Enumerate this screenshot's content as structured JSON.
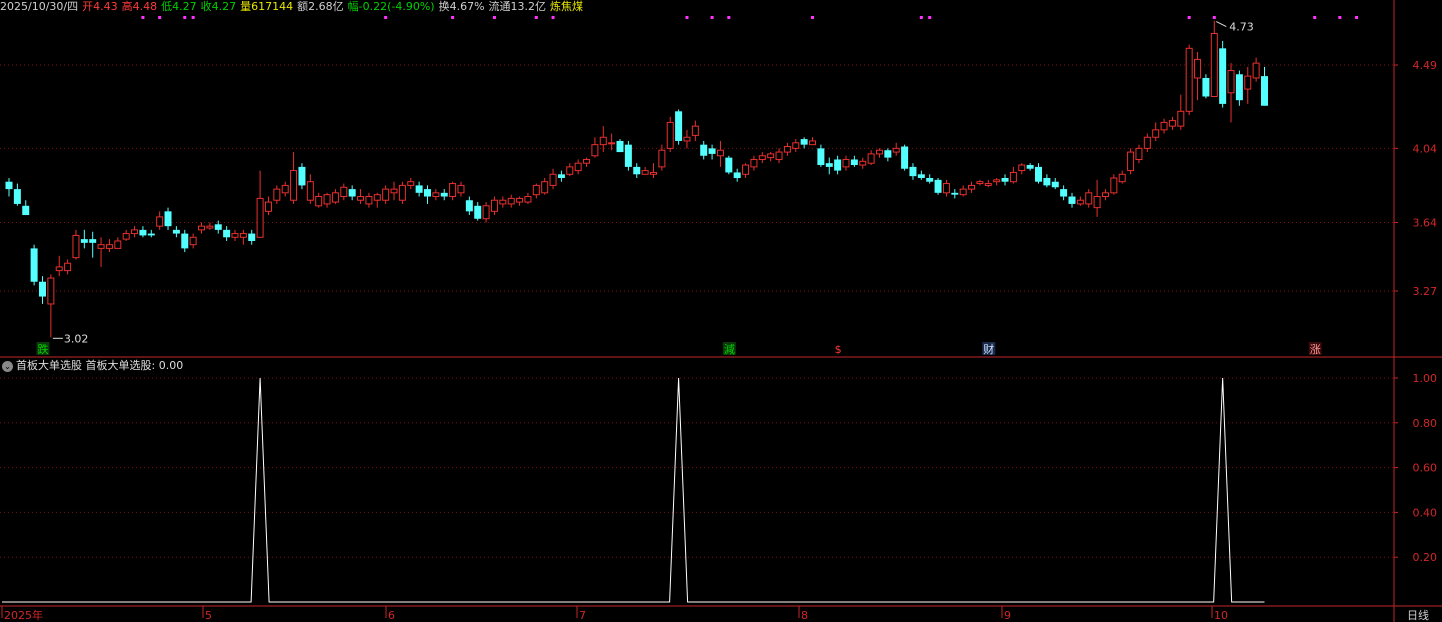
{
  "header": {
    "date": "2025/10/30/四",
    "open_label": "开",
    "open": "4.43",
    "high_label": "高",
    "high": "4.48",
    "low_label": "低",
    "low": "4.27",
    "close_label": "收",
    "close": "4.27",
    "vol_label": "量",
    "vol": "617144",
    "amount_label": "额",
    "amount": "2.68亿",
    "change_label": "幅",
    "change": "-0.22(-4.90%)",
    "turnover_label": "换",
    "turnover": "4.67%",
    "float_label": "流通",
    "float": "13.2亿",
    "sector": "炼焦煤"
  },
  "indicator": {
    "name": "首板大单选股",
    "value_text": "首板大单选股: 0.00"
  },
  "period_label": "日线",
  "colors": {
    "up": "#e8302e",
    "down": "#54ffff",
    "grid": "#7a1010",
    "axis": "#c4262a",
    "indicator": "#ffffff",
    "marker": "#ff33ff",
    "high_color": "#ff3b3b",
    "low_color": "#00d000"
  },
  "chart_data": {
    "type": "candlestick",
    "price_axis": {
      "ticks": [
        4.49,
        4.04,
        3.64,
        3.27
      ],
      "labels": [
        "4.49",
        "4.04",
        "3.64",
        "3.27"
      ]
    },
    "indicator_axis": {
      "ticks": [
        1.0,
        0.8,
        0.6,
        0.4,
        0.2
      ],
      "labels": [
        "1.00",
        "0.80",
        "0.60",
        "0.40",
        "0.20"
      ],
      "ylim": [
        0,
        1
      ]
    },
    "x_labels": [
      "2025年",
      "5",
      "6",
      "7",
      "8",
      "9",
      "10"
    ],
    "annotations": {
      "high": "4.73",
      "low": "3.02"
    },
    "event_labels": [
      "跌",
      "減",
      "$",
      "财",
      "涨"
    ],
    "candles": [
      [
        3.86,
        3.82,
        3.88,
        3.78
      ],
      [
        3.82,
        3.74,
        3.85,
        3.73
      ],
      [
        3.73,
        3.68,
        3.76,
        3.68
      ],
      [
        3.5,
        3.32,
        3.52,
        3.3
      ],
      [
        3.32,
        3.24,
        3.35,
        3.2
      ],
      [
        3.2,
        3.34,
        3.36,
        3.02
      ],
      [
        3.38,
        3.4,
        3.46,
        3.35
      ],
      [
        3.38,
        3.42,
        3.44,
        3.36
      ],
      [
        3.45,
        3.57,
        3.6,
        3.44
      ],
      [
        3.55,
        3.53,
        3.6,
        3.5
      ],
      [
        3.55,
        3.53,
        3.59,
        3.45
      ],
      [
        3.5,
        3.52,
        3.56,
        3.4
      ],
      [
        3.5,
        3.52,
        3.55,
        3.48
      ],
      [
        3.5,
        3.54,
        3.56,
        3.5
      ],
      [
        3.55,
        3.58,
        3.6,
        3.54
      ],
      [
        3.58,
        3.6,
        3.62,
        3.56
      ],
      [
        3.6,
        3.57,
        3.62,
        3.56
      ],
      [
        3.58,
        3.57,
        3.6,
        3.56
      ],
      [
        3.62,
        3.67,
        3.7,
        3.6
      ],
      [
        3.7,
        3.62,
        3.72,
        3.6
      ],
      [
        3.6,
        3.58,
        3.62,
        3.56
      ],
      [
        3.58,
        3.5,
        3.6,
        3.48
      ],
      [
        3.52,
        3.56,
        3.58,
        3.5
      ],
      [
        3.6,
        3.62,
        3.64,
        3.58
      ],
      [
        3.61,
        3.62,
        3.64,
        3.6
      ],
      [
        3.63,
        3.6,
        3.65,
        3.58
      ],
      [
        3.6,
        3.56,
        3.62,
        3.54
      ],
      [
        3.56,
        3.58,
        3.6,
        3.54
      ],
      [
        3.56,
        3.58,
        3.6,
        3.52
      ],
      [
        3.58,
        3.54,
        3.6,
        3.52
      ],
      [
        3.56,
        3.77,
        3.92,
        3.56
      ],
      [
        3.7,
        3.75,
        3.78,
        3.68
      ],
      [
        3.76,
        3.82,
        3.84,
        3.74
      ],
      [
        3.8,
        3.84,
        3.86,
        3.78
      ],
      [
        3.76,
        3.92,
        4.02,
        3.74
      ],
      [
        3.94,
        3.84,
        3.96,
        3.82
      ],
      [
        3.76,
        3.86,
        3.9,
        3.74
      ],
      [
        3.73,
        3.78,
        3.8,
        3.72
      ],
      [
        3.74,
        3.79,
        3.8,
        3.72
      ],
      [
        3.75,
        3.8,
        3.82,
        3.74
      ],
      [
        3.78,
        3.83,
        3.85,
        3.76
      ],
      [
        3.82,
        3.78,
        3.84,
        3.76
      ],
      [
        3.76,
        3.78,
        3.82,
        3.74
      ],
      [
        3.74,
        3.78,
        3.8,
        3.72
      ],
      [
        3.76,
        3.79,
        3.8,
        3.72
      ],
      [
        3.76,
        3.82,
        3.84,
        3.74
      ],
      [
        3.8,
        3.82,
        3.86,
        3.76
      ],
      [
        3.76,
        3.84,
        3.86,
        3.74
      ],
      [
        3.84,
        3.86,
        3.88,
        3.82
      ],
      [
        3.84,
        3.8,
        3.86,
        3.78
      ],
      [
        3.82,
        3.78,
        3.84,
        3.74
      ],
      [
        3.78,
        3.8,
        3.82,
        3.76
      ],
      [
        3.8,
        3.78,
        3.82,
        3.76
      ],
      [
        3.78,
        3.85,
        3.86,
        3.76
      ],
      [
        3.8,
        3.84,
        3.86,
        3.78
      ],
      [
        3.76,
        3.7,
        3.78,
        3.68
      ],
      [
        3.73,
        3.66,
        3.75,
        3.65
      ],
      [
        3.66,
        3.73,
        3.75,
        3.64
      ],
      [
        3.7,
        3.76,
        3.78,
        3.68
      ],
      [
        3.74,
        3.76,
        3.78,
        3.72
      ],
      [
        3.74,
        3.77,
        3.79,
        3.72
      ],
      [
        3.75,
        3.77,
        3.78,
        3.73
      ],
      [
        3.75,
        3.78,
        3.8,
        3.74
      ],
      [
        3.79,
        3.84,
        3.85,
        3.77
      ],
      [
        3.8,
        3.86,
        3.88,
        3.79
      ],
      [
        3.84,
        3.9,
        3.93,
        3.82
      ],
      [
        3.9,
        3.88,
        3.92,
        3.86
      ],
      [
        3.9,
        3.94,
        3.96,
        3.89
      ],
      [
        3.92,
        3.96,
        3.98,
        3.9
      ],
      [
        3.96,
        3.98,
        3.99,
        3.94
      ],
      [
        4.0,
        4.06,
        4.1,
        3.99
      ],
      [
        4.06,
        4.1,
        4.16,
        4.02
      ],
      [
        4.07,
        4.07,
        4.12,
        4.03
      ],
      [
        4.08,
        4.02,
        4.09,
        4.02
      ],
      [
        4.06,
        3.94,
        4.08,
        3.92
      ],
      [
        3.94,
        3.9,
        3.96,
        3.88
      ],
      [
        3.9,
        3.92,
        3.94,
        3.9
      ],
      [
        3.9,
        3.91,
        3.96,
        3.88
      ],
      [
        3.94,
        4.03,
        4.06,
        3.92
      ],
      [
        4.04,
        4.18,
        4.21,
        4.02
      ],
      [
        4.24,
        4.08,
        4.25,
        4.06
      ],
      [
        4.08,
        4.1,
        4.14,
        4.04
      ],
      [
        4.11,
        4.16,
        4.19,
        4.08
      ],
      [
        4.06,
        4.0,
        4.08,
        3.98
      ],
      [
        4.04,
        4.01,
        4.06,
        3.98
      ],
      [
        4.0,
        4.03,
        4.08,
        3.94
      ],
      [
        3.99,
        3.91,
        4.0,
        3.9
      ],
      [
        3.91,
        3.88,
        3.93,
        3.86
      ],
      [
        3.9,
        3.95,
        3.96,
        3.88
      ],
      [
        3.94,
        3.98,
        4.0,
        3.92
      ],
      [
        3.98,
        4.0,
        4.02,
        3.96
      ],
      [
        3.99,
        4.01,
        4.02,
        3.97
      ],
      [
        3.98,
        4.02,
        4.04,
        3.96
      ],
      [
        4.02,
        4.05,
        4.07,
        4.0
      ],
      [
        4.04,
        4.07,
        4.09,
        4.02
      ],
      [
        4.09,
        4.06,
        4.1,
        4.04
      ],
      [
        4.06,
        4.08,
        4.1,
        4.06
      ],
      [
        4.04,
        3.95,
        4.06,
        3.94
      ],
      [
        3.96,
        3.94,
        3.99,
        3.9
      ],
      [
        3.98,
        3.92,
        4.0,
        3.9
      ],
      [
        3.94,
        3.98,
        4.0,
        3.92
      ],
      [
        3.98,
        3.95,
        4.0,
        3.94
      ],
      [
        3.95,
        3.97,
        3.99,
        3.93
      ],
      [
        3.96,
        4.01,
        4.03,
        3.95
      ],
      [
        4.01,
        4.03,
        4.04,
        3.99
      ],
      [
        4.03,
        3.99,
        4.04,
        3.97
      ],
      [
        4.02,
        4.04,
        4.07,
        4.0
      ],
      [
        4.05,
        3.93,
        4.06,
        3.92
      ],
      [
        3.94,
        3.89,
        3.96,
        3.87
      ],
      [
        3.9,
        3.88,
        3.92,
        3.87
      ],
      [
        3.88,
        3.86,
        3.9,
        3.85
      ],
      [
        3.87,
        3.8,
        3.88,
        3.79
      ],
      [
        3.8,
        3.85,
        3.87,
        3.78
      ],
      [
        3.8,
        3.79,
        3.82,
        3.77
      ],
      [
        3.79,
        3.82,
        3.84,
        3.78
      ],
      [
        3.82,
        3.84,
        3.86,
        3.8
      ],
      [
        3.85,
        3.86,
        3.87,
        3.84
      ],
      [
        3.84,
        3.85,
        3.87,
        3.83
      ],
      [
        3.86,
        3.87,
        3.88,
        3.84
      ],
      [
        3.88,
        3.86,
        3.9,
        3.84
      ],
      [
        3.86,
        3.91,
        3.94,
        3.85
      ],
      [
        3.92,
        3.95,
        3.96,
        3.9
      ],
      [
        3.95,
        3.93,
        3.96,
        3.92
      ],
      [
        3.94,
        3.86,
        3.96,
        3.85
      ],
      [
        3.88,
        3.84,
        3.9,
        3.83
      ],
      [
        3.86,
        3.83,
        3.88,
        3.82
      ],
      [
        3.82,
        3.78,
        3.84,
        3.76
      ],
      [
        3.78,
        3.74,
        3.8,
        3.72
      ],
      [
        3.74,
        3.76,
        3.78,
        3.73
      ],
      [
        3.74,
        3.8,
        3.82,
        3.72
      ],
      [
        3.72,
        3.78,
        3.87,
        3.67
      ],
      [
        3.78,
        3.8,
        3.82,
        3.76
      ],
      [
        3.8,
        3.88,
        3.9,
        3.79
      ],
      [
        3.86,
        3.9,
        3.92,
        3.85
      ],
      [
        3.92,
        4.02,
        4.04,
        3.9
      ],
      [
        3.98,
        4.04,
        4.06,
        3.96
      ],
      [
        4.04,
        4.1,
        4.12,
        4.02
      ],
      [
        4.1,
        4.14,
        4.18,
        4.08
      ],
      [
        4.14,
        4.18,
        4.2,
        4.12
      ],
      [
        4.16,
        4.19,
        4.21,
        4.14
      ],
      [
        4.16,
        4.24,
        4.33,
        4.14
      ],
      [
        4.24,
        4.58,
        4.6,
        4.22
      ],
      [
        4.42,
        4.52,
        4.56,
        4.3
      ],
      [
        4.42,
        4.32,
        4.44,
        4.31
      ],
      [
        4.32,
        4.66,
        4.73,
        4.32
      ],
      [
        4.58,
        4.28,
        4.62,
        4.26
      ],
      [
        4.34,
        4.46,
        4.5,
        4.18
      ],
      [
        4.44,
        4.3,
        4.46,
        4.27
      ],
      [
        4.36,
        4.43,
        4.48,
        4.28
      ],
      [
        4.42,
        4.5,
        4.53,
        4.4
      ],
      [
        4.43,
        4.27,
        4.48,
        4.27
      ]
    ],
    "signal_peaks": [
      30,
      80,
      145
    ],
    "top_markers": [
      16,
      18,
      21,
      22,
      45,
      53,
      58,
      63,
      65,
      81,
      84,
      86,
      96,
      109,
      110,
      141,
      144,
      156,
      159,
      161
    ]
  }
}
